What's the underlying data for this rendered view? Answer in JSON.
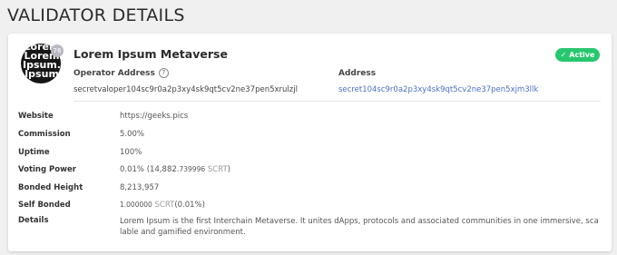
{
  "page": {
    "title": "VALIDATOR DETAILS"
  },
  "validator": {
    "avatar_text": "Lorem\nLorem\nIpsum.\nIpsum",
    "badge_count": "76",
    "name": "Lorem Ipsum Metaverse",
    "status": "Active",
    "operator_address_label": "Operator Address",
    "operator_address": "secretvaloper104sc9r0a2p3xy4sk9qt5cv2ne37pen5xrulzjl",
    "address_label": "Address",
    "address": "secret104sc9r0a2p3xy4sk9qt5cv2ne37pen5xjm3llk"
  },
  "details": {
    "website_label": "Website",
    "website": "https://geeks.pics",
    "commission_label": "Commission",
    "commission": "5.00%",
    "uptime_label": "Uptime",
    "uptime": "100%",
    "voting_power_label": "Voting Power",
    "voting_power_pct": "0.01%",
    "voting_power_open": " (14,882.",
    "voting_power_decimals": "739996",
    "voting_power_unit": " SCRT",
    "voting_power_close": ")",
    "bonded_height_label": "Bonded Height",
    "bonded_height": "8,213,957",
    "self_bonded_label": "Self Bonded",
    "self_bonded_value": "1.000000",
    "self_bonded_unit": " SCRT",
    "self_bonded_pct": "(0.01%)",
    "description_label": "Details",
    "description": "Lorem Ipsum is the first Interchain Metaverse. It unites dApps, protocols and associated communities in one immersive, scalable and gamified environment."
  },
  "colors": {
    "status": "#28c76f",
    "link": "#4a70c7"
  }
}
